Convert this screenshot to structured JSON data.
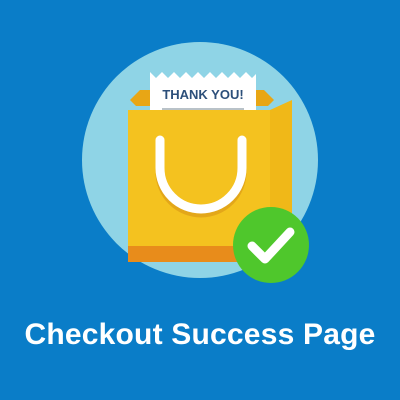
{
  "colors": {
    "background": "#0a7dc8",
    "circle": "#8fd4e6",
    "bag_front": "#f4c21f",
    "bag_back": "#e8a615",
    "bag_side": "#f0b818",
    "bag_bottom": "#e88c1b",
    "handle": "#ffffff",
    "handle_shadow": "#e3a719",
    "receipt": "#ffffff",
    "receipt_text": "#2c4f7a",
    "receipt_lines": "#b9c2c8",
    "check_circle": "#4fc72c",
    "check_mark": "#ffffff",
    "caption": "#ffffff"
  },
  "receipt": {
    "text": "THANK YOU!"
  },
  "illustration": {
    "object_icon": "shopping-bag-icon",
    "status_icon": "checkmark-icon"
  },
  "caption": {
    "text": "Checkout Success Page"
  }
}
